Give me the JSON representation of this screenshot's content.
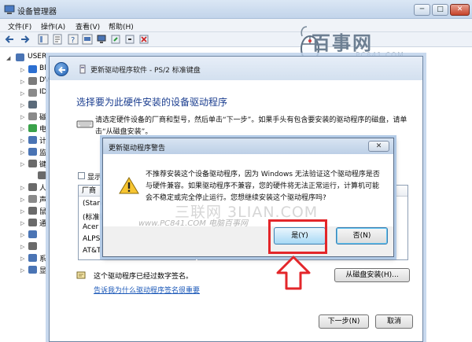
{
  "device_manager": {
    "title": "设备管理器",
    "window_controls": {
      "minimize": "─",
      "maximize": "□",
      "close": "✕"
    },
    "menu": [
      "文件(F)",
      "操作(A)",
      "查看(V)",
      "帮助(H)"
    ],
    "tree_root": "USER",
    "tree_items": [
      {
        "label": "Bl",
        "icon": "bluetooth-icon",
        "color": "#2c6fd1"
      },
      {
        "label": "DV",
        "icon": "dvd-drive-icon",
        "color": "#7b7b7b"
      },
      {
        "label": "ID",
        "icon": "ide-controller-icon",
        "color": "#8a8a8a"
      },
      {
        "label": "",
        "icon": "processor-icon",
        "color": "#5a6a7a"
      },
      {
        "label": "磁",
        "icon": "disk-drive-icon",
        "color": "#8a8a8a"
      },
      {
        "label": "电",
        "icon": "battery-icon",
        "color": "#3aa24a"
      },
      {
        "label": "计",
        "icon": "computer-icon",
        "color": "#4a74b4"
      },
      {
        "label": "监",
        "icon": "monitor-icon",
        "color": "#4a74b4"
      },
      {
        "label": "键",
        "icon": "keyboard-icon",
        "color": "#6a6a6a"
      },
      {
        "label": "",
        "icon": "ps2-keyboard-device-icon",
        "color": "#6a6a6a"
      },
      {
        "label": "人",
        "icon": "hid-icon",
        "color": "#6a6a6a"
      },
      {
        "label": "声",
        "icon": "sound-icon",
        "color": "#8a8a8a"
      },
      {
        "label": "鼠",
        "icon": "mouse-icon",
        "color": "#6a6a6a"
      },
      {
        "label": "通",
        "icon": "usb-icon",
        "color": "#6a6a6a"
      },
      {
        "label": "",
        "icon": "network-adapter-icon",
        "color": "#4a74b4"
      },
      {
        "label": "",
        "icon": "port-icon",
        "color": "#6a6a6a"
      },
      {
        "label": "系",
        "icon": "system-device-icon",
        "color": "#4a74b4"
      },
      {
        "label": "显",
        "icon": "display-adapter-icon",
        "color": "#4a74b4"
      }
    ]
  },
  "watermark": {
    "brand": "百事网",
    "domain": "PC841.COM",
    "overlay_large": "三联网 3LIAN.COM",
    "overlay_small": "www.PC841.COM 电脑百事网"
  },
  "wizard": {
    "title": "更新驱动程序软件 - PS/2 标准键盘",
    "heading": "选择要为此硬件安装的设备驱动程序",
    "instruction": "请选定硬件设备的厂商和型号，然后单击“下一步”。如果手头有包含要安装的驱动程序的磁盘，请单击“从磁盘安装”。",
    "compatible_label": "显示",
    "manufacturer_header": "厂商",
    "manufacturers": [
      "(Stand",
      "(标准键",
      "Acer",
      "ALPS",
      "AT&T"
    ],
    "signed_text": "这个驱动程序已经过数字签名。",
    "signing_link": "告诉我为什么驱动程序签名很重要",
    "have_disk_button": "从磁盘安装(H)...",
    "next_button": "下一步(N)",
    "cancel_button": "取消"
  },
  "dialog": {
    "title": "更新驱动程序警告",
    "close": "✕",
    "message": "不推荐安装这个设备驱动程序，因为 Windows 无法验证这个驱动程序是否与硬件兼容。如果驱动程序不兼容，您的硬件将无法正常运行，计算机可能会不稳定或完全停止运行。您想继续安装这个驱动程序吗?",
    "yes_button": "是(Y)",
    "no_button": "否(N)"
  },
  "colors": {
    "highlight": "#e3262a",
    "heading": "#1a3d8f",
    "link": "#1b58b8"
  }
}
